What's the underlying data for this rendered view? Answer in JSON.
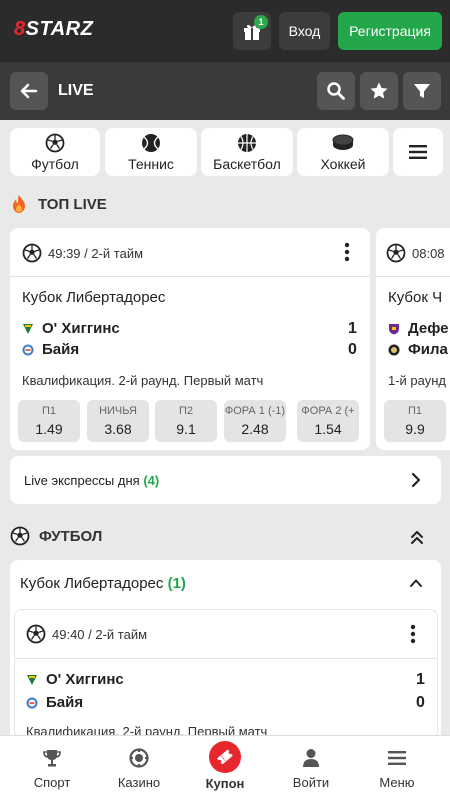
{
  "header": {
    "logo_prefix": "8",
    "logo_text": "STARZ",
    "gift_badge": "1",
    "login_label": "Вход",
    "register_label": "Регистрация"
  },
  "subheader": {
    "title": "LIVE"
  },
  "sports_tabs": [
    {
      "label": "Футбол",
      "icon": "soccer-ball-icon"
    },
    {
      "label": "Теннис",
      "icon": "tennis-ball-icon"
    },
    {
      "label": "Баскетбол",
      "icon": "basketball-icon"
    },
    {
      "label": "Хоккей",
      "icon": "hockey-puck-icon"
    }
  ],
  "top_live": {
    "title": "ТОП LIVE",
    "cards": [
      {
        "time": "49:39 / 2-й тайм",
        "league": "Кубок Либертадорес",
        "team1": "О' Хиггинс",
        "team2": "Байя",
        "score1": "1",
        "score2": "0",
        "stage": "Квалификация. 2-й раунд. Первый матч",
        "odds": [
          {
            "label": "П1",
            "value": "1.49"
          },
          {
            "label": "НИЧЬЯ",
            "value": "3.68"
          },
          {
            "label": "П2",
            "value": "9.1"
          },
          {
            "label": "ФОРА 1 (-1)",
            "value": "2.48"
          },
          {
            "label": "ФОРА 2 (+",
            "value": "1.54"
          }
        ]
      },
      {
        "time": "08:08",
        "league": "Кубок Ч",
        "team1": "Дефе",
        "team2": "Фила",
        "stage": "1-й раунд",
        "odds": [
          {
            "label": "П1",
            "value": "9.9"
          }
        ]
      }
    ]
  },
  "express": {
    "label": "Live экспрессы дня",
    "count": "(4)"
  },
  "football": {
    "title": "ФУТБОЛ",
    "league": "Кубок Либертадорес",
    "league_count": "(1)",
    "match": {
      "time": "49:40 / 2-й тайм",
      "team1": "О' Хиггинс",
      "team2": "Байя",
      "score1": "1",
      "score2": "0",
      "stage": "Квалификация. 2-й раунд. Первый матч"
    }
  },
  "bottom_nav": [
    {
      "label": "Спорт",
      "icon": "trophy-icon"
    },
    {
      "label": "Казино",
      "icon": "casino-chip-icon"
    },
    {
      "label": "Купон",
      "icon": "ticket-icon"
    },
    {
      "label": "Войти",
      "icon": "user-icon"
    },
    {
      "label": "Меню",
      "icon": "menu-icon"
    }
  ]
}
